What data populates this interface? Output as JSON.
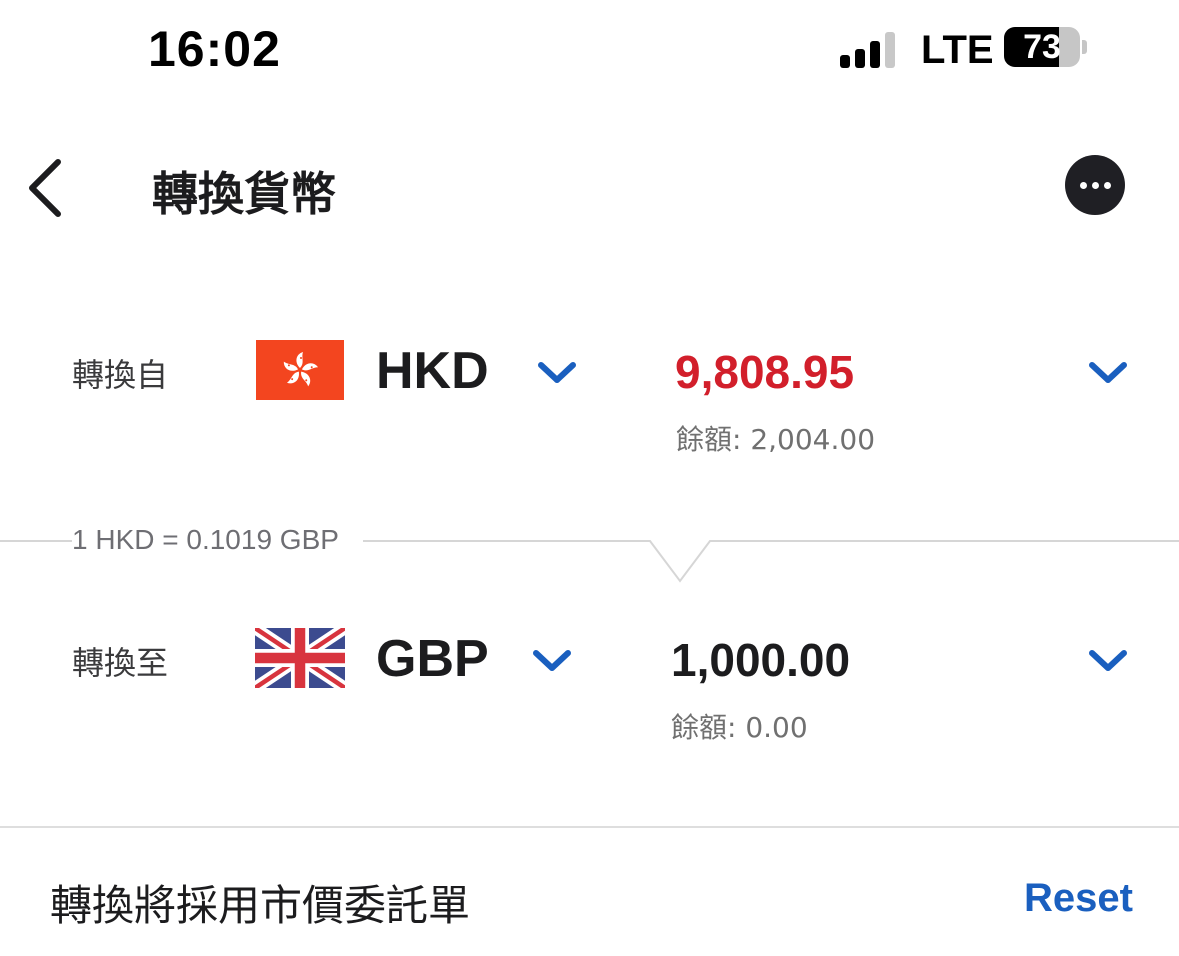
{
  "status_bar": {
    "time": "16:02",
    "network": "LTE",
    "battery": "73",
    "battery_level": 0.73
  },
  "nav": {
    "title": "轉換貨幣"
  },
  "from": {
    "label": "轉換自",
    "currency": "HKD",
    "amount": "9,808.95",
    "balance": "餘額: 2,004.00",
    "amount_color": "#d21f2b"
  },
  "rate": {
    "text": "1 HKD = 0.1019 GBP"
  },
  "to": {
    "label": "轉換至",
    "currency": "GBP",
    "amount": "1,000.00",
    "balance": "餘額: 0.00",
    "amount_color": "#1c1c1e"
  },
  "footer": {
    "note": "轉換將採用市價委託單",
    "reset_label": "Reset"
  },
  "colors": {
    "accent": "#1a5fbf",
    "hk_flag": "#f3451f",
    "uk_blue": "#3c4b8f",
    "uk_red": "#d8343e"
  },
  "icons": {
    "back": "chevron-left-icon",
    "more": "more-horizontal-icon",
    "dropdown": "chevron-down-icon"
  }
}
